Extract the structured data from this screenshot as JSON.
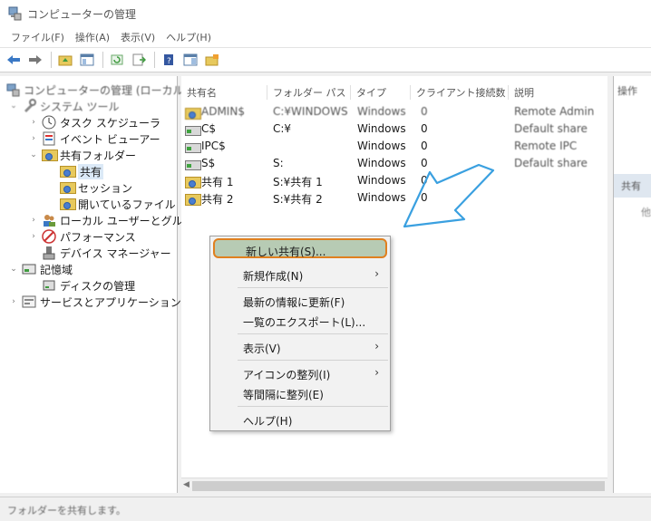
{
  "window": {
    "title": "コンピューターの管理"
  },
  "menubar": [
    "ファイル(F)",
    "操作(A)",
    "表示(V)",
    "ヘルプ(H)"
  ],
  "tree": {
    "root": "コンピューターの管理 (ローカル)",
    "system_tools": "システム ツール",
    "task_scheduler": "タスク スケジューラ",
    "event_viewer": "イベント ビューアー",
    "shared_folders": "共有フォルダー",
    "shares": "共有",
    "sessions": "セッション",
    "open_files": "開いているファイル",
    "local_users": "ローカル ユーザーとグループ",
    "performance": "パフォーマンス",
    "device_manager": "デバイス マネージャー",
    "storage": "記憶域",
    "disk_management": "ディスクの管理",
    "services_apps": "サービスとアプリケーション"
  },
  "list": {
    "headers": {
      "name": "共有名",
      "path": "フォルダー パス",
      "type": "タイプ",
      "clients": "クライアント接続数",
      "desc": "説明"
    },
    "rows": [
      {
        "name": "ADMIN$",
        "path": "C:¥WINDOWS",
        "type": "Windows",
        "clients": "0",
        "desc": "Remote Admin"
      },
      {
        "name": "C$",
        "path": "C:¥",
        "type": "Windows",
        "clients": "0",
        "desc": "Default share"
      },
      {
        "name": "IPC$",
        "path": "",
        "type": "Windows",
        "clients": "0",
        "desc": "Remote IPC"
      },
      {
        "name": "S$",
        "path": "S:",
        "type": "Windows",
        "clients": "0",
        "desc": "Default share"
      },
      {
        "name": "共有 1",
        "path": "S:¥共有 1",
        "type": "Windows",
        "clients": "0",
        "desc": ""
      },
      {
        "name": "共有 2",
        "path": "S:¥共有 2",
        "type": "Windows",
        "clients": "0",
        "desc": ""
      }
    ]
  },
  "actions": {
    "header": "操作",
    "selected": "共有",
    "more": "他"
  },
  "status": "フォルダーを共有します。",
  "context_menu": {
    "new_share": "新しい共有(S)...",
    "new": "新規作成(N)",
    "refresh": "最新の情報に更新(F)",
    "export": "一覧のエクスポート(L)...",
    "view": "表示(V)",
    "arrange_icons": "アイコンの整列(I)",
    "line_up": "等間隔に整列(E)",
    "help": "ヘルプ(H)",
    "submenu_arrow": "›"
  },
  "colors": {
    "highlight_fill": "#b7cbb4",
    "highlight_border": "#e0801f",
    "arrow": "#3aa0e0"
  }
}
